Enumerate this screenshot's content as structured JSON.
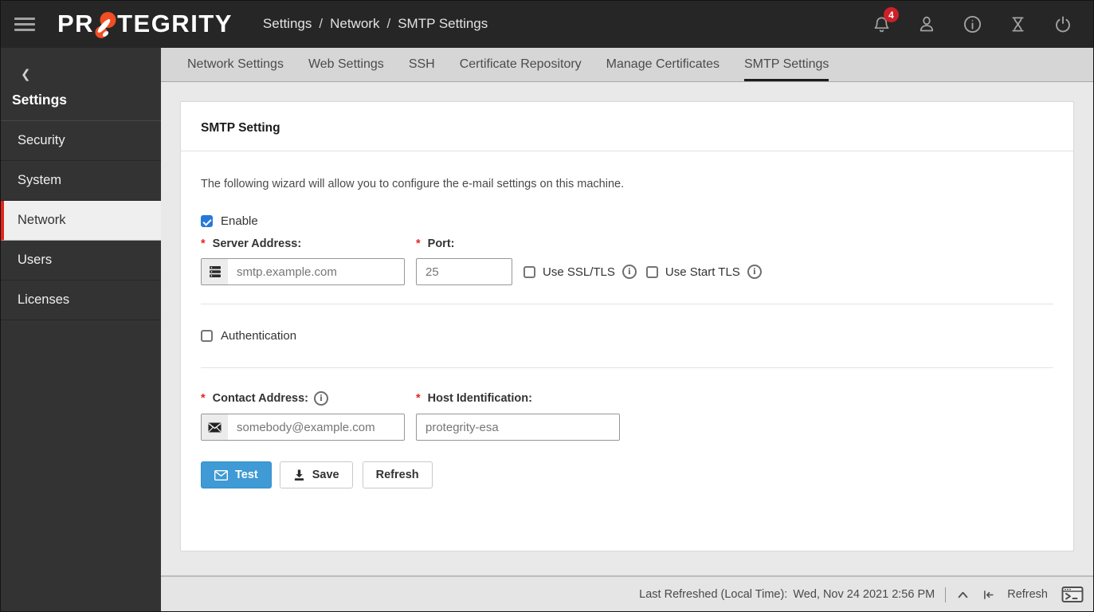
{
  "header": {
    "logo_pre": "PR",
    "logo_post": "TEGRITY",
    "breadcrumb": [
      "Settings",
      "Network",
      "SMTP Settings"
    ],
    "breadcrumb_separator": "/",
    "notification_count": "4"
  },
  "sidebar": {
    "title": "Settings",
    "items": [
      {
        "label": "Security",
        "active": false
      },
      {
        "label": "System",
        "active": false
      },
      {
        "label": "Network",
        "active": true
      },
      {
        "label": "Users",
        "active": false
      },
      {
        "label": "Licenses",
        "active": false
      }
    ]
  },
  "tabs": [
    {
      "label": "Network Settings",
      "active": false
    },
    {
      "label": "Web Settings",
      "active": false
    },
    {
      "label": "SSH",
      "active": false
    },
    {
      "label": "Certificate Repository",
      "active": false
    },
    {
      "label": "Manage Certificates",
      "active": false
    },
    {
      "label": "SMTP Settings",
      "active": true
    }
  ],
  "form": {
    "card_title": "SMTP Setting",
    "description": "The following wizard will allow you to configure the e-mail settings on this machine.",
    "enable": {
      "label": "Enable",
      "checked": true
    },
    "server_address": {
      "label": "Server Address:",
      "required": "*",
      "value": "smtp.example.com"
    },
    "port": {
      "label": "Port:",
      "required": "*",
      "value": "25"
    },
    "use_ssl": {
      "label": "Use SSL/TLS",
      "checked": false
    },
    "use_starttls": {
      "label": "Use Start TLS",
      "checked": false
    },
    "authentication": {
      "label": "Authentication",
      "checked": false
    },
    "contact_address": {
      "label": "Contact Address:",
      "required": "*",
      "value": "somebody@example.com"
    },
    "host_identification": {
      "label": "Host Identification:",
      "required": "*",
      "value": "protegrity-esa"
    },
    "buttons": {
      "test": "Test",
      "save": "Save",
      "refresh": "Refresh"
    }
  },
  "footer": {
    "last_refreshed_label": "Last Refreshed (Local Time):",
    "last_refreshed_value": "Wed, Nov 24 2021 2:56 PM",
    "refresh_label": "Refresh"
  },
  "colors": {
    "brand_orange": "#f04e23",
    "accent_blue": "#3f9ad5",
    "checkbox_blue": "#2778d9",
    "active_red": "#e1251b",
    "badge_red": "#ce2029",
    "header_bg": "#262626",
    "sidebar_bg": "#333333",
    "tabbar_bg": "#d6d6d6",
    "content_bg": "#e9e9e9"
  }
}
